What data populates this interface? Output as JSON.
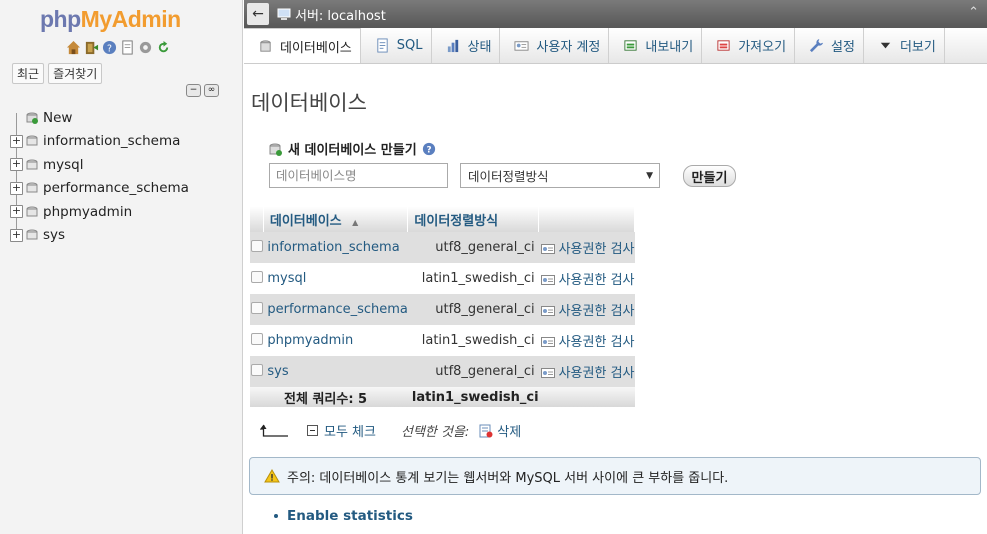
{
  "nav": {
    "logo_php": "php",
    "logo_myadmin": "MyAdmin",
    "icons": [
      "home-icon",
      "exit-icon",
      "help-icon",
      "docs-icon",
      "settings-icon",
      "reload-icon"
    ],
    "tabs": [
      "최근",
      "즐겨찾기"
    ],
    "tree": [
      {
        "label": "New"
      },
      {
        "label": "information_schema"
      },
      {
        "label": "mysql"
      },
      {
        "label": "performance_schema"
      },
      {
        "label": "phpmyadmin"
      },
      {
        "label": "sys"
      }
    ]
  },
  "topbar": {
    "back_glyph": "←",
    "server_label": "서버: localhost"
  },
  "tabs": [
    {
      "label": "데이터베이스",
      "icon": "database-icon",
      "active": true
    },
    {
      "label": "SQL",
      "icon": "sql-icon"
    },
    {
      "label": "상태",
      "icon": "status-icon"
    },
    {
      "label": "사용자 계정",
      "icon": "users-icon"
    },
    {
      "label": "내보내기",
      "icon": "export-icon"
    },
    {
      "label": "가져오기",
      "icon": "import-icon"
    },
    {
      "label": "설정",
      "icon": "wrench-icon"
    },
    {
      "label": "더보기",
      "icon": "chevron-down-icon"
    }
  ],
  "main": {
    "title": "데이터베이스",
    "create": {
      "heading": "새 데이터베이스 만들기",
      "name_placeholder": "데이터베이스명",
      "collation_value": "데이터정렬방식",
      "button": "만들기"
    },
    "table": {
      "headers": [
        "데이터베이스",
        "데이터정렬방식"
      ],
      "rows": [
        {
          "name": "information_schema",
          "collation": "utf8_general_ci",
          "action": "사용권한 검사"
        },
        {
          "name": "mysql",
          "collation": "latin1_swedish_ci",
          "action": "사용권한 검사"
        },
        {
          "name": "performance_schema",
          "collation": "utf8_general_ci",
          "action": "사용권한 검사"
        },
        {
          "name": "phpmyadmin",
          "collation": "latin1_swedish_ci",
          "action": "사용권한 검사"
        },
        {
          "name": "sys",
          "collation": "utf8_general_ci",
          "action": "사용권한 검사"
        }
      ],
      "total_label": "전체 쿼리수: 5",
      "total_collation": "latin1_swedish_ci"
    },
    "bulk": {
      "check_all": "모두 체크",
      "with_selected": "선택한 것을:",
      "delete": "삭제"
    },
    "notice": "주의: 데이터베이스 통계 보기는 웹서버와 MySQL 서버 사이에 큰 부하를 줍니다.",
    "enable_stats": "Enable statistics"
  },
  "colors": {
    "link": "#235a81",
    "logo_php": "#6c78af",
    "logo_myadmin": "#f29c2f",
    "topbar": "#666666"
  }
}
